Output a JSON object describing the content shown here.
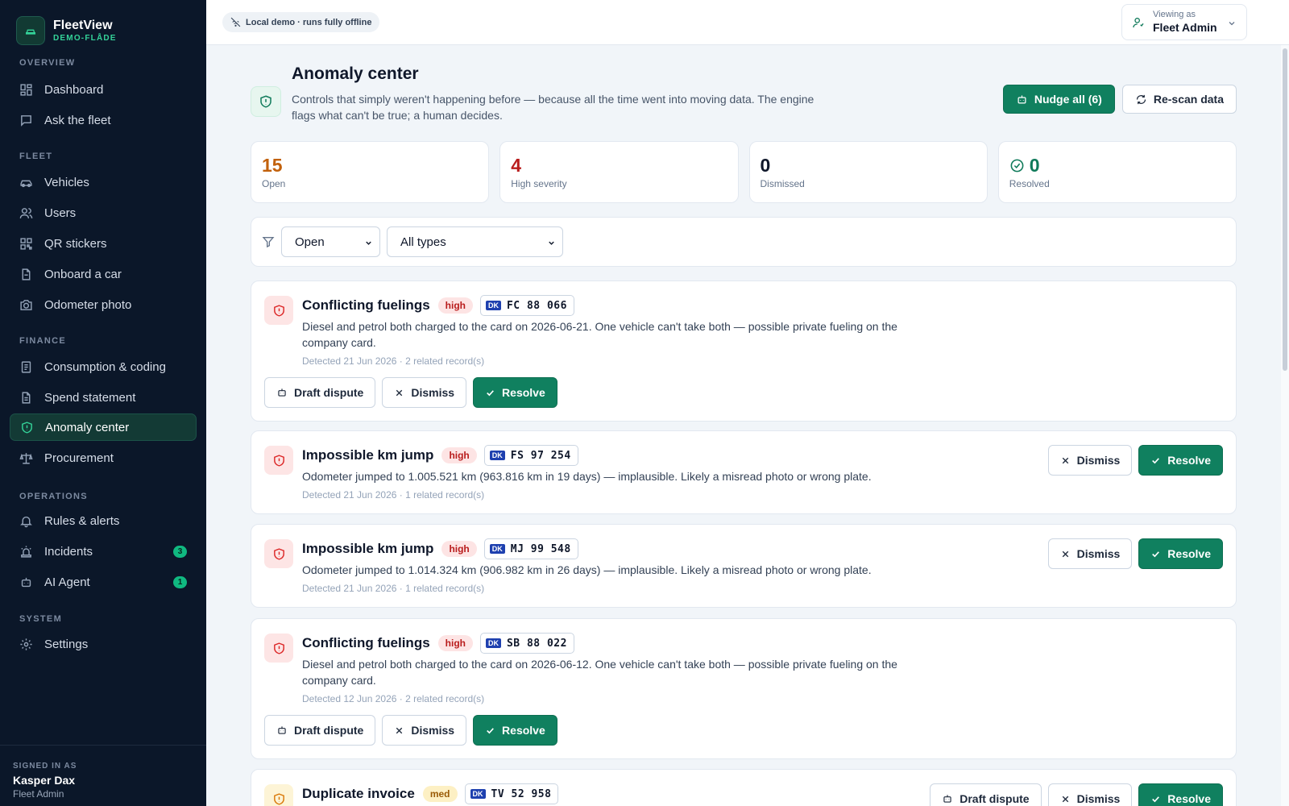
{
  "app": {
    "name": "FleetView",
    "subtitle": "DEMO-FLÅDE"
  },
  "sidebar": {
    "sections": [
      {
        "title": "OVERVIEW",
        "items": [
          {
            "label": "Dashboard",
            "icon": "dashboard-icon"
          },
          {
            "label": "Ask the fleet",
            "icon": "chat-icon"
          }
        ]
      },
      {
        "title": "FLEET",
        "items": [
          {
            "label": "Vehicles",
            "icon": "car-icon"
          },
          {
            "label": "Users",
            "icon": "users-icon"
          },
          {
            "label": "QR stickers",
            "icon": "qr-icon"
          },
          {
            "label": "Onboard a car",
            "icon": "onboard-icon"
          },
          {
            "label": "Odometer photo",
            "icon": "camera-icon"
          }
        ]
      },
      {
        "title": "FINANCE",
        "items": [
          {
            "label": "Consumption & coding",
            "icon": "document-icon"
          },
          {
            "label": "Spend statement",
            "icon": "statement-icon"
          },
          {
            "label": "Anomaly center",
            "icon": "shield-icon",
            "active": true
          },
          {
            "label": "Procurement",
            "icon": "scale-icon"
          }
        ]
      },
      {
        "title": "OPERATIONS",
        "items": [
          {
            "label": "Rules & alerts",
            "icon": "bell-icon"
          },
          {
            "label": "Incidents",
            "icon": "siren-icon",
            "badge": "3"
          },
          {
            "label": "AI Agent",
            "icon": "robot-icon",
            "badge": "1"
          }
        ]
      },
      {
        "title": "SYSTEM",
        "items": [
          {
            "label": "Settings",
            "icon": "gear-icon"
          }
        ]
      }
    ],
    "footer": {
      "label": "SIGNED IN AS",
      "name": "Kasper Dax",
      "role": "Fleet Admin"
    }
  },
  "topbar": {
    "demo_pill": "Local demo · runs fully offline",
    "viewing_label": "Viewing as",
    "viewing_value": "Fleet Admin"
  },
  "page": {
    "title": "Anomaly center",
    "description": "Controls that simply weren't happening before — because all the time went into moving data. The engine flags what can't be true; a human decides.",
    "nudge_label": "Nudge all (6)",
    "rescan_label": "Re-scan data"
  },
  "stats": [
    {
      "value": "15",
      "label": "Open",
      "color": "#c2610c"
    },
    {
      "value": "4",
      "label": "High severity",
      "color": "#b91c1c"
    },
    {
      "value": "0",
      "label": "Dismissed",
      "color": "#0f172a"
    },
    {
      "value": "0",
      "label": "Resolved",
      "color": "#0f7a5a",
      "icon": "check-circle-icon"
    }
  ],
  "filters": {
    "status_value": "Open",
    "type_value": "All types"
  },
  "actions": {
    "draft_dispute": "Draft dispute",
    "dismiss": "Dismiss",
    "resolve": "Resolve"
  },
  "anomalies": [
    {
      "title": "Conflicting fuelings",
      "severity": "high",
      "plate_country": "DK",
      "plate": "FC 88 066",
      "description": "Diesel and petrol both charged to the card on 2026-06-21. One vehicle can't take both — possible private fueling on the company card.",
      "meta": "Detected 21 Jun 2026 · 2 related record(s)"
    },
    {
      "title": "Impossible km jump",
      "severity": "high",
      "plate_country": "DK",
      "plate": "FS 97 254",
      "description": "Odometer jumped to 1.005.521 km (963.816 km in 19 days) — implausible. Likely a misread photo or wrong plate.",
      "meta": "Detected 21 Jun 2026 · 1 related record(s)"
    },
    {
      "title": "Impossible km jump",
      "severity": "high",
      "plate_country": "DK",
      "plate": "MJ 99 548",
      "description": "Odometer jumped to 1.014.324 km (906.982 km in 26 days) — implausible. Likely a misread photo or wrong plate.",
      "meta": "Detected 21 Jun 2026 · 1 related record(s)"
    },
    {
      "title": "Conflicting fuelings",
      "severity": "high",
      "plate_country": "DK",
      "plate": "SB 88 022",
      "description": "Diesel and petrol both charged to the card on 2026-06-12. One vehicle can't take both — possible private fueling on the company card.",
      "meta": "Detected 12 Jun 2026 · 2 related record(s)"
    },
    {
      "title": "Duplicate invoice",
      "severity": "med",
      "plate_country": "DK",
      "plate": "TV 52 958"
    }
  ]
}
